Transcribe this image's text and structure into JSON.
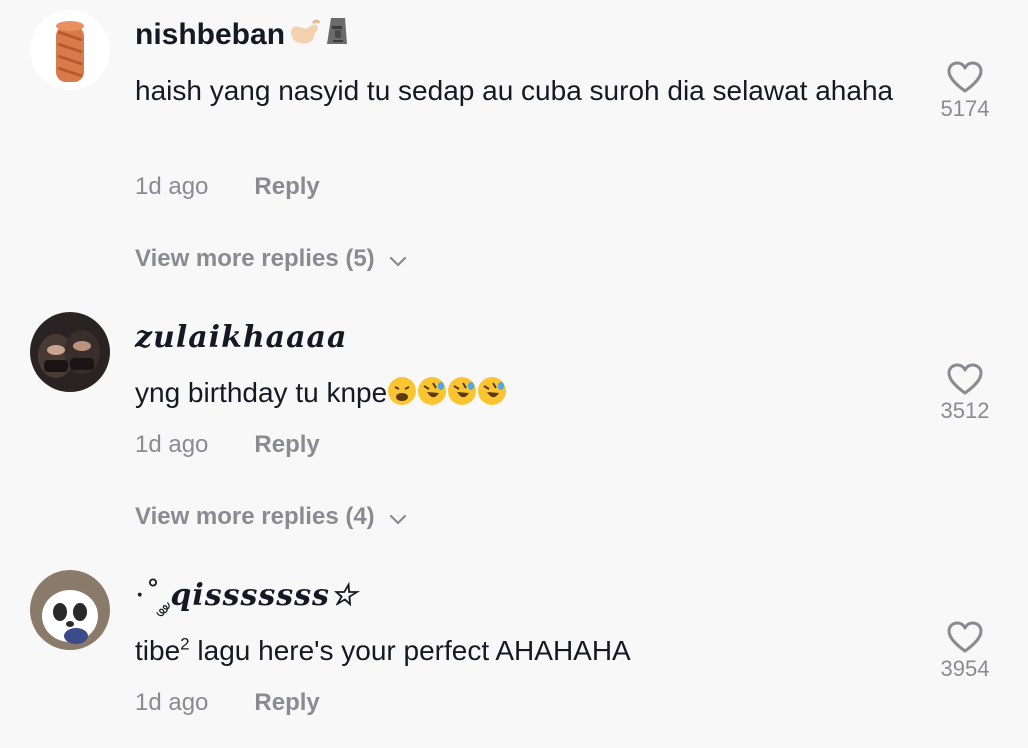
{
  "comments": [
    {
      "username": "nishbeban",
      "username_emojis": [
        "call-me-hand",
        "moai"
      ],
      "text": "haish yang nasyid tu sedap au cuba suroh dia selawat ahaha",
      "time": "1d ago",
      "reply_label": "Reply",
      "likes": "5174",
      "more_replies": "View more replies (5)"
    },
    {
      "username": "zulaikhaaaa",
      "text": "yng birthday tu knpe",
      "text_emojis": [
        "weary-face",
        "rolling-laughing",
        "rolling-laughing",
        "rolling-laughing"
      ],
      "time": "1d ago",
      "reply_label": "Reply",
      "likes": "3512",
      "more_replies": "View more replies (4)"
    },
    {
      "username_prefix": "·˚ ༘",
      "username": "qisssssss☆",
      "text_main": "tibe",
      "text_sup": "2",
      "text_rest": " lagu here's your perfect AHAHAHA",
      "time": "1d ago",
      "reply_label": "Reply",
      "likes": "3954"
    }
  ],
  "colors": {
    "background": "#f8f8f8",
    "primary_text": "#161823",
    "secondary_text": "#8a8b91"
  }
}
